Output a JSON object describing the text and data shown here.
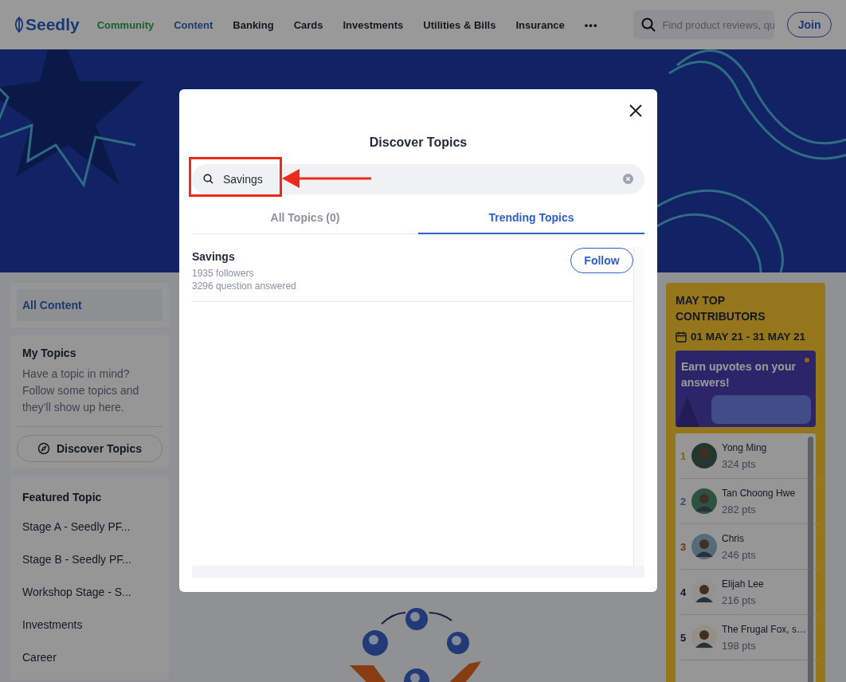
{
  "header": {
    "logo": "Seedly",
    "nav": [
      {
        "label": "Community",
        "color": "#1c5f2f"
      },
      {
        "label": "Content",
        "color": "#1c3976"
      },
      {
        "label": "Banking",
        "color": "#131921"
      },
      {
        "label": "Cards",
        "color": "#131921"
      },
      {
        "label": "Investments",
        "color": "#131921"
      },
      {
        "label": "Utilities & Bills",
        "color": "#131921"
      },
      {
        "label": "Insurance",
        "color": "#131921"
      }
    ],
    "more": "•••",
    "search": {
      "placeholder": "Find product reviews, qu"
    },
    "join": "Join"
  },
  "sidebar": {
    "all_content": {
      "label": "All Content",
      "selected": true
    },
    "my_topics": {
      "title": "My Topics",
      "text": "Have a topic in mind? Follow some topics and they’ll show up here.",
      "button": "Discover Topics"
    },
    "featured": {
      "title": "Featured Topic",
      "items": [
        "Stage A - Seedly PF...",
        "Stage B - Seedly PF...",
        "Workshop Stage - S...",
        "Investments",
        "Career"
      ]
    }
  },
  "contributors": {
    "title": "MAY TOP CONTRIBUTORS",
    "dates": "01 MAY 21 - 31 MAY 21",
    "banner": "Earn upvotes on your answers!",
    "items": [
      {
        "rank": "1",
        "color": "#826110",
        "name": "Yong Ming",
        "points": "324 pts"
      },
      {
        "rank": "2",
        "color": "#374c73",
        "name": "Tan Choong Hwe",
        "points": "282 pts"
      },
      {
        "rank": "3",
        "color": "#763113",
        "name": "Chris",
        "points": "246 pts"
      },
      {
        "rank": "4",
        "color": "#131921",
        "name": "Elijah Lee",
        "points": "216 pts"
      },
      {
        "rank": "5",
        "color": "#131921",
        "name": "The Frugal Fox, s…",
        "points": "198 pts"
      }
    ]
  },
  "modal": {
    "title": "Discover Topics",
    "search": {
      "value": "Savings"
    },
    "tabs": [
      {
        "label": "All Topics (0)",
        "selected": false
      },
      {
        "label": "Trending Topics",
        "selected": true
      }
    ],
    "results": [
      {
        "name": "Savings",
        "followers": "1935 followers",
        "answered": "3296 question answered",
        "button": "Follow"
      }
    ]
  }
}
